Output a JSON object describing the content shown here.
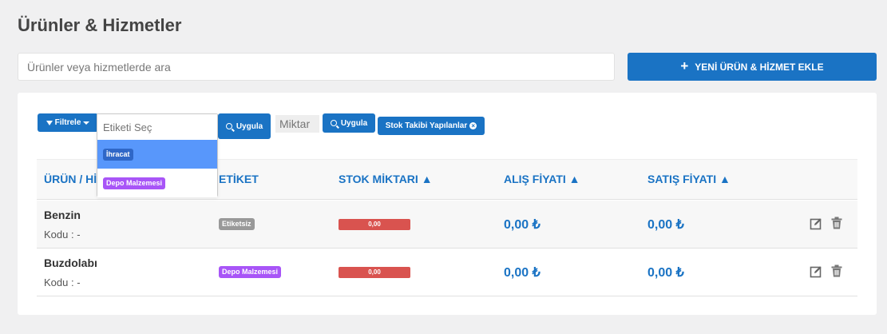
{
  "page": {
    "title": "Ürünler & Hizmetler"
  },
  "search": {
    "placeholder": "Ürünler veya hizmetlerde ara"
  },
  "toolbar": {
    "add_label": "YENİ ÜRÜN & HİZMET EKLE"
  },
  "filters": {
    "filter_label": "Filtrele",
    "tag_select_placeholder": "Etiketi Seç",
    "apply_label_1": "Uygula",
    "quantity_placeholder": "Miktar",
    "apply_label_2": "Uygula",
    "active_chip": "Stok Takibi Yapılanlar"
  },
  "dropdown": {
    "options": [
      {
        "label": "İhracat",
        "highlighted": true,
        "color": "#2f67c7"
      },
      {
        "label": "Depo Malzemesi",
        "highlighted": false,
        "color": "#a855f7"
      }
    ]
  },
  "table": {
    "headers": {
      "product": "ÜRÜN / HİZ",
      "tag": "ETİKET",
      "stock": "STOK MİKTARI ▲",
      "buy_price": "ALIŞ FİYATI ▲",
      "sell_price": "SATIŞ FİYATI ▲"
    },
    "rows": [
      {
        "name": "Benzin",
        "code": "Kodu : -",
        "tag": "Etiketsiz",
        "tag_color": "#999999",
        "stock": "0,00",
        "buy_price": "0,00 ₺",
        "sell_price": "0,00 ₺"
      },
      {
        "name": "Buzdolabı",
        "code": "Kodu : -",
        "tag": "Depo Malzemesi",
        "tag_color": "#a855f7",
        "stock": "0,00",
        "buy_price": "0,00 ₺",
        "sell_price": "0,00 ₺"
      }
    ]
  },
  "colors": {
    "primary": "#1a73c4",
    "danger": "#d9534f",
    "highlight": "#5897fb"
  }
}
